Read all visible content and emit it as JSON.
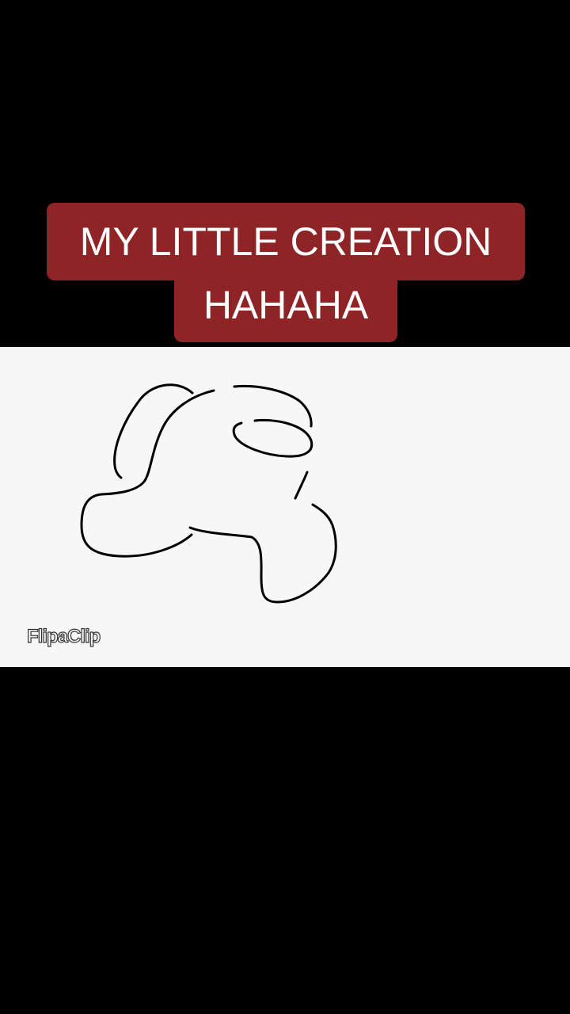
{
  "caption": {
    "line1": "MY LITTLE CREATION",
    "line2": "HAHAHA"
  },
  "canvas": {
    "watermark": "FlipaClip"
  },
  "colors": {
    "background": "#000000",
    "caption_bg": "#8e2426",
    "caption_text": "#ffffff",
    "canvas_bg": "#f7f7f7",
    "stroke": "#000000"
  }
}
